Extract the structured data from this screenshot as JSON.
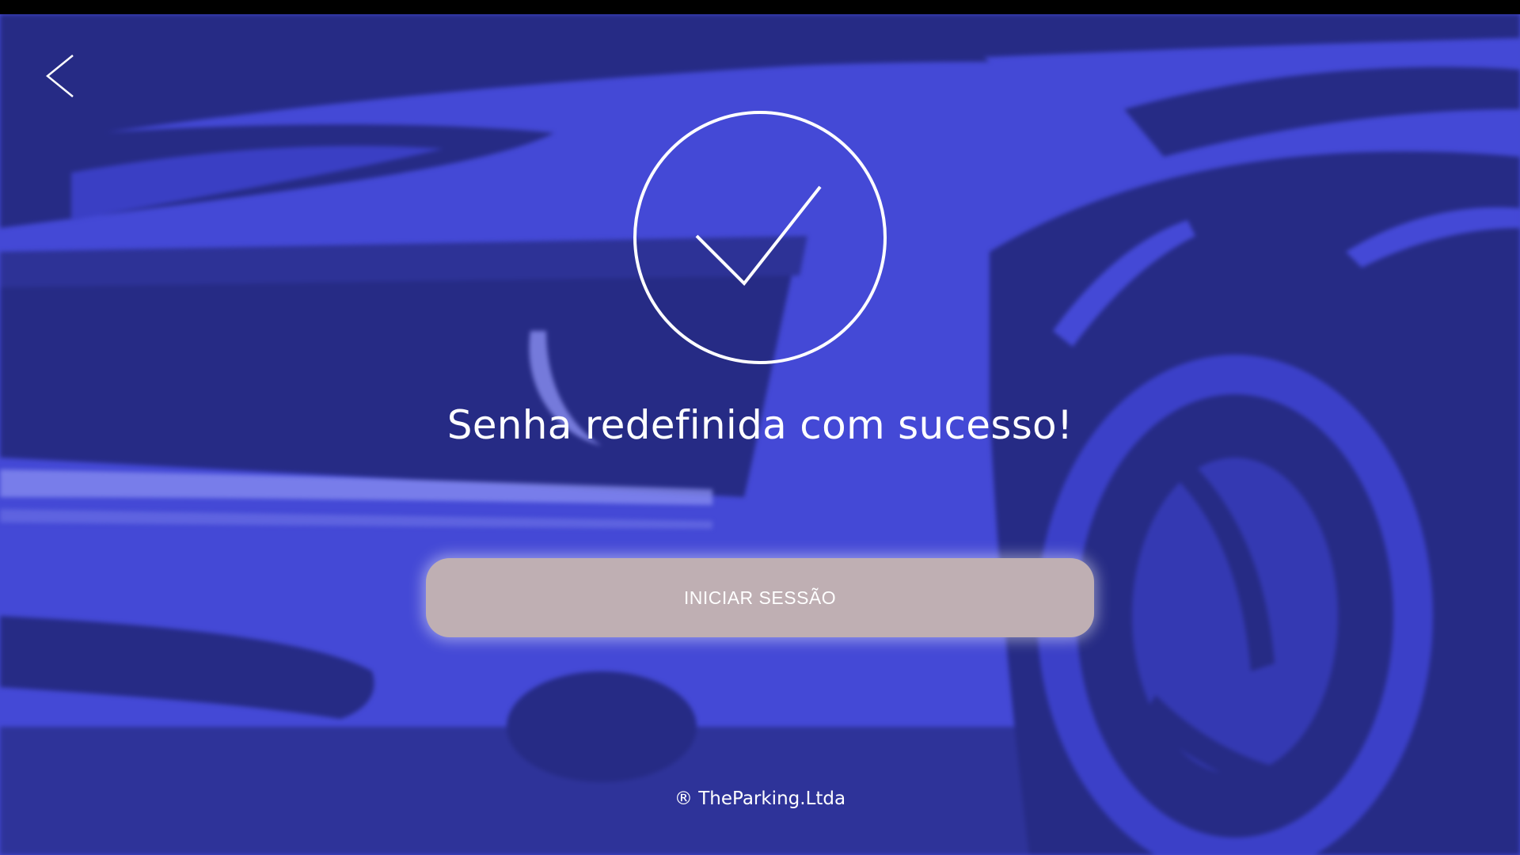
{
  "screen": {
    "background_color": "#4449d6",
    "shadow_color": "#262b85"
  },
  "header": {
    "back_icon": "chevron-left-icon"
  },
  "status": {
    "icon": "check-circle-icon",
    "title": "Senha redefinida com sucesso!"
  },
  "actions": {
    "primary_label": "INICIAR SESSÃO",
    "primary_color": "#bfafb3"
  },
  "footer": {
    "copyright": "® TheParking.Ltda"
  }
}
